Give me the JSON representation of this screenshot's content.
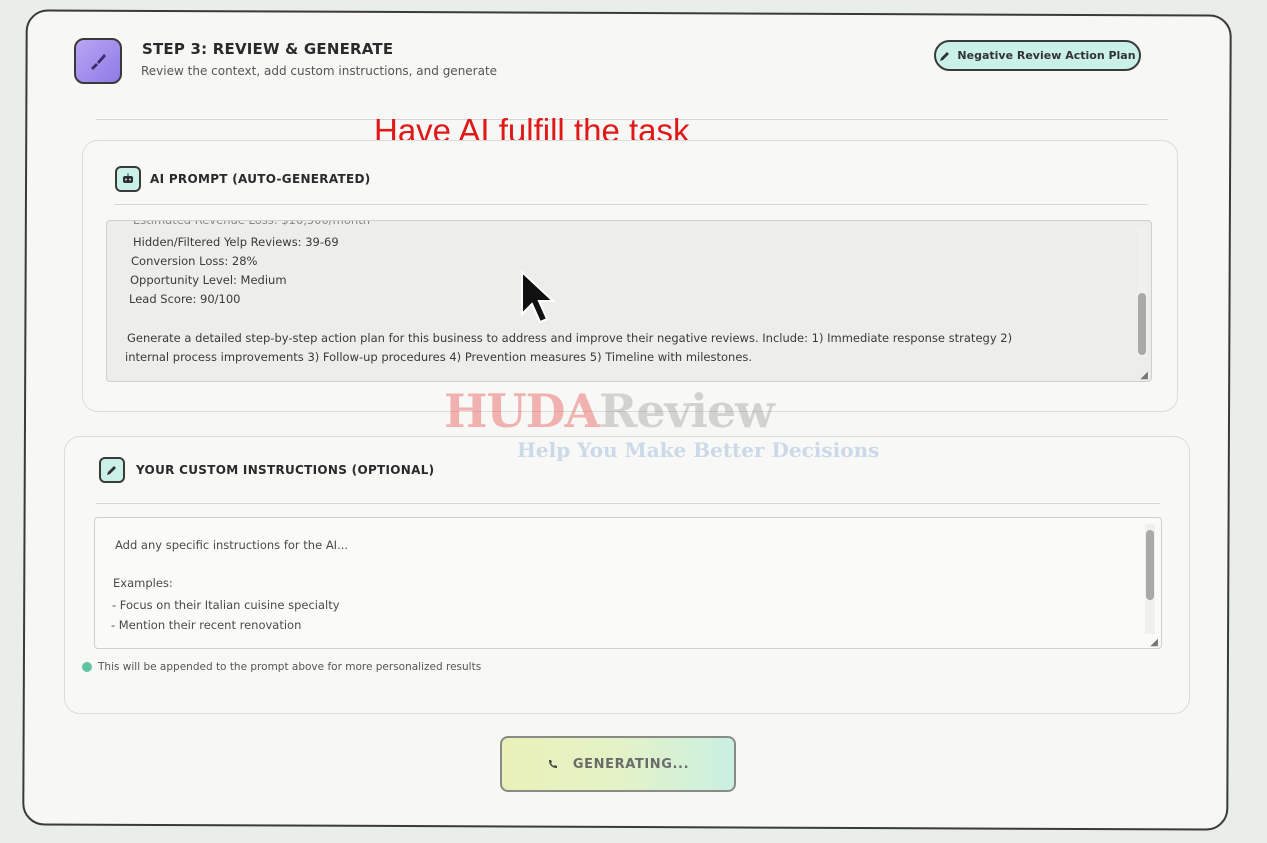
{
  "header": {
    "step_title": "STEP 3: REVIEW & GENERATE",
    "step_subtitle": "Review the context, add custom instructions, and generate",
    "action_button": "Negative Review Action Plan"
  },
  "overlay_caption": "Have AI fulfill the task",
  "ai_prompt": {
    "title": "AI PROMPT (AUTO-GENERATED)",
    "lines": [
      "Hidden/Filtered Yelp Reviews: 39-69",
      "Conversion Loss: 28%",
      "Opportunity Level: Medium",
      "Lead Score: 90/100",
      "",
      "Generate a detailed step-by-step action plan for this business to address and improve their negative reviews. Include: 1) Immediate response strategy 2)",
      "internal process improvements 3) Follow-up procedures 4) Prevention measures 5) Timeline with milestones."
    ]
  },
  "custom": {
    "title": "YOUR CUSTOM INSTRUCTIONS (OPTIONAL)",
    "placeholder_lines": [
      "Add any specific instructions for the AI...",
      "",
      "Examples:",
      "- Focus on their Italian cuisine specialty",
      "- Mention their recent renovation"
    ],
    "hint": "This will be appended to the prompt above for more personalized results"
  },
  "generate_button": "GENERATING...",
  "watermark": {
    "brand_a": "HUDA",
    "brand_b": "Review",
    "tagline": "Help You Make Better Decisions"
  },
  "icons": {
    "step": "brush-icon",
    "action": "pencil-icon",
    "ai": "robot-icon",
    "custom": "pencil-icon",
    "spinner": "phone-icon",
    "info": "info-icon"
  }
}
